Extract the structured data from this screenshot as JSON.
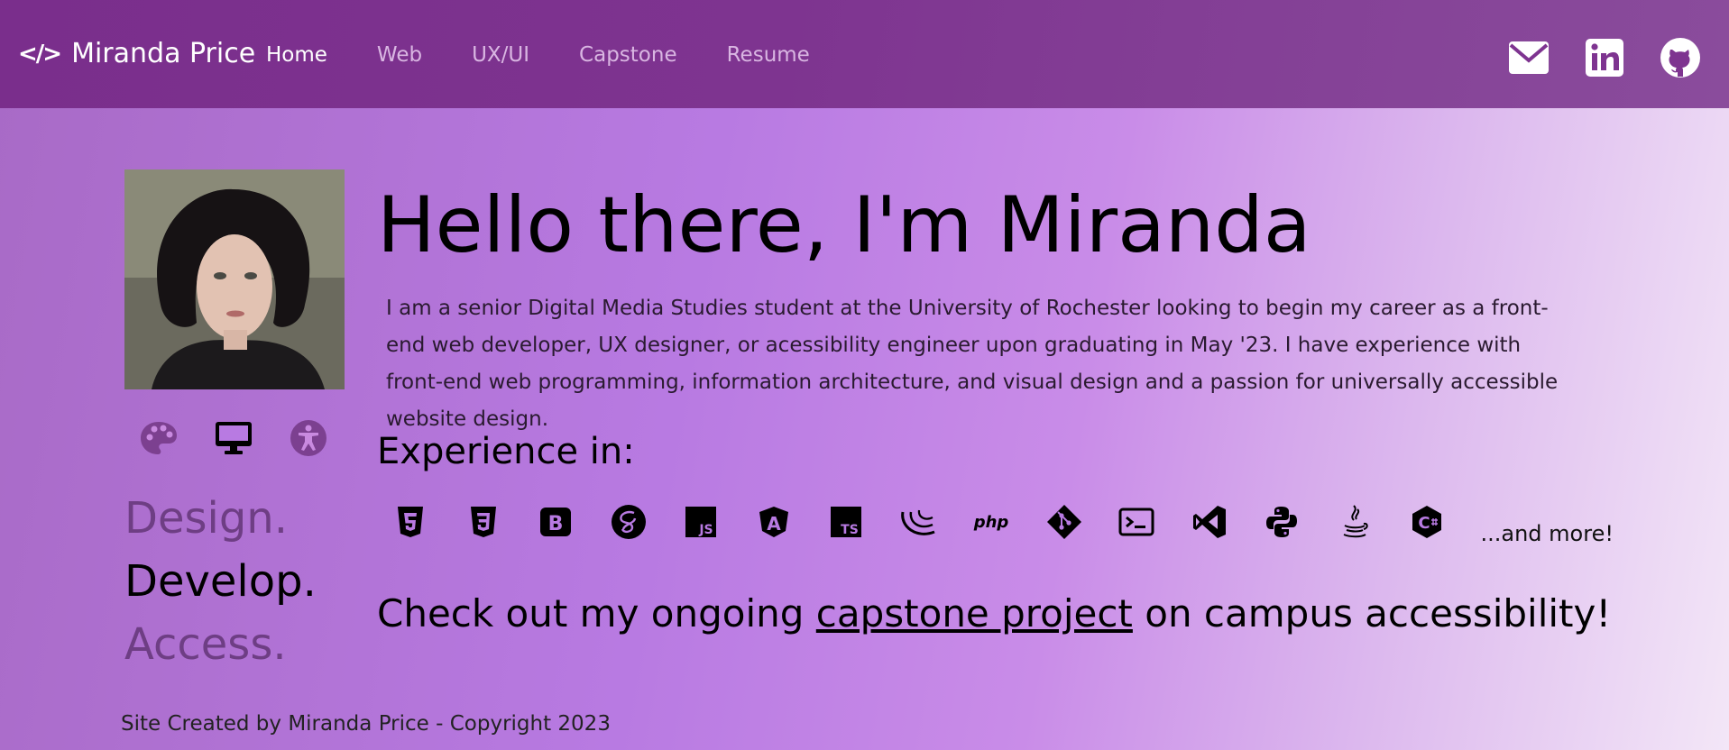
{
  "nav": {
    "brand": "Miranda Price",
    "brand_icon": "code-icon",
    "links": [
      {
        "label": "Home",
        "active": true
      },
      {
        "label": "Web",
        "active": false
      },
      {
        "label": "UX/UI",
        "active": false
      },
      {
        "label": "Capstone",
        "active": false
      },
      {
        "label": "Resume",
        "active": false
      }
    ],
    "social": [
      "mail-icon",
      "linkedin-icon",
      "github-icon"
    ]
  },
  "sidebar": {
    "skill_icons": [
      "palette-icon",
      "monitor-icon",
      "accessibility-icon"
    ],
    "taglines": [
      "Design.",
      "Develop.",
      "Access."
    ],
    "active_tagline": "Develop."
  },
  "hero": {
    "title": "Hello there, I'm Miranda",
    "intro": "I am a senior Digital Media Studies student at the University of Rochester looking to begin my career as a front-end web developer, UX designer, or acessibility engineer upon graduating in May '23. I have experience with front-end web programming, information architecture, and visual design and a passion for universally accessible website design."
  },
  "experience": {
    "title": "Experience in:",
    "techs": [
      "html5-icon",
      "css3-icon",
      "bootstrap-icon",
      "sass-icon",
      "javascript-icon",
      "angular-icon",
      "typescript-icon",
      "jquery-icon",
      "php-icon",
      "git-icon",
      "terminal-icon",
      "vscode-icon",
      "python-icon",
      "java-icon",
      "csharp-icon"
    ],
    "more": "...and more!",
    "labels": {
      "js": "JS",
      "ts": "TS",
      "php": "php",
      "b": "B",
      "a": "A",
      "c": "C"
    }
  },
  "cta": {
    "before": "Check out my ongoing ",
    "link": "capstone project",
    "after": " on campus accessibility!"
  },
  "footer": {
    "text": "Site Created by Miranda Price - Copyright 2023"
  },
  "colors": {
    "nav": "#7a2e8c",
    "nav_link": "#d9b6e2",
    "dim_tagline": "#6e3e84"
  }
}
